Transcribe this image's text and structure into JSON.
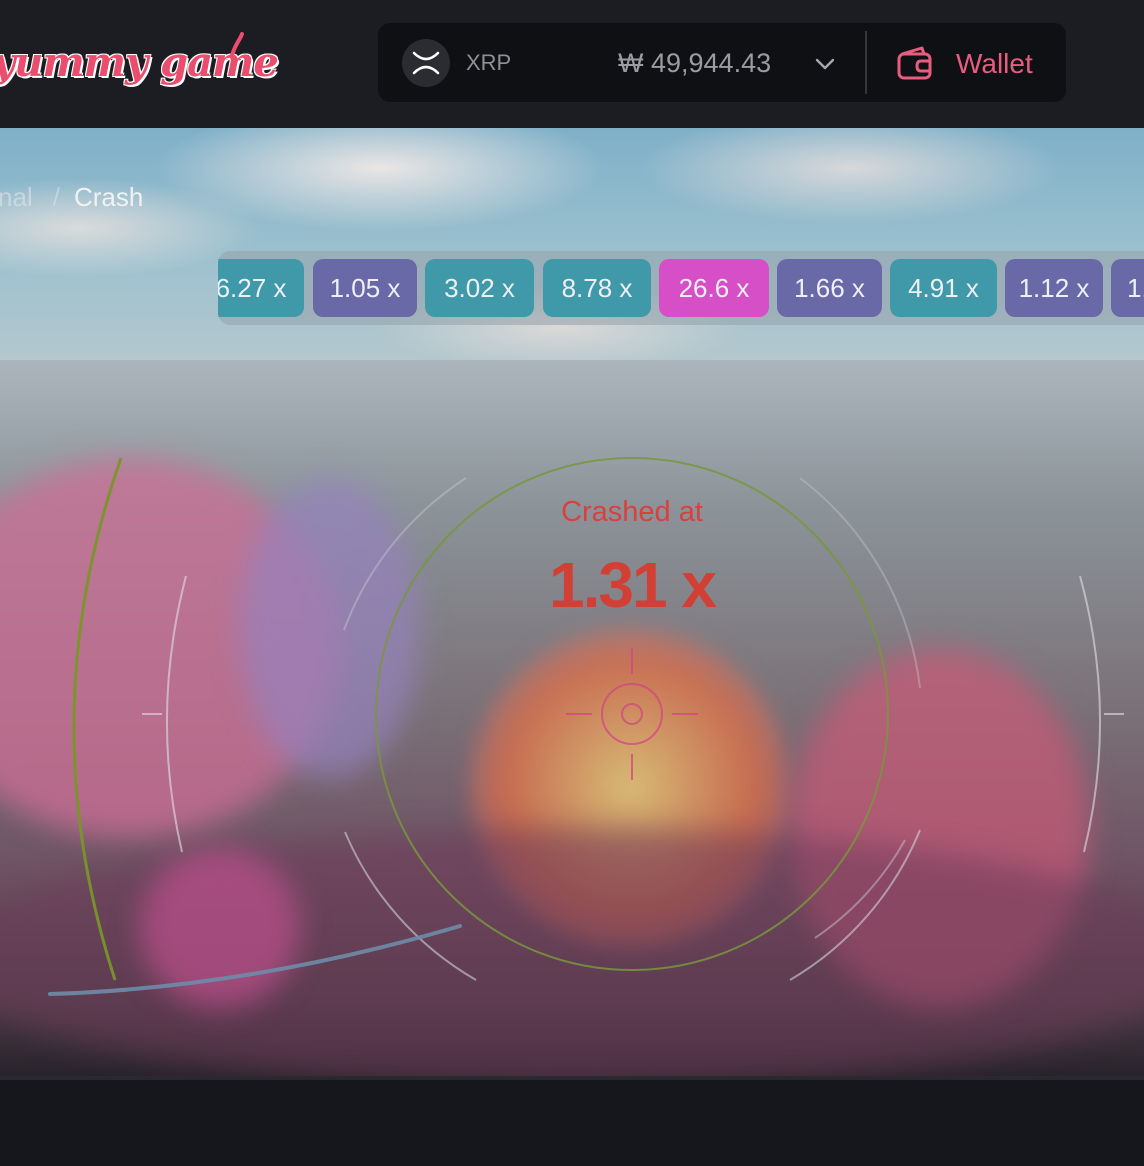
{
  "header": {
    "logo_text": "yummy game",
    "currency": {
      "code": "XRP",
      "icon": "xrp-icon"
    },
    "balance": "₩ 49,944.43",
    "wallet_label": "Wallet",
    "accent_color": "#ea5b80"
  },
  "breadcrumb": {
    "previous": "nal",
    "separator": "/",
    "current": "Crash"
  },
  "history": [
    {
      "label": "6.27 x",
      "tone": "teal"
    },
    {
      "label": "1.05 x",
      "tone": "purple"
    },
    {
      "label": "3.02 x",
      "tone": "teal"
    },
    {
      "label": "8.78 x",
      "tone": "teal"
    },
    {
      "label": "26.6 x",
      "tone": "pink"
    },
    {
      "label": "1.66 x",
      "tone": "purple"
    },
    {
      "label": "4.91 x",
      "tone": "teal"
    },
    {
      "label": "1.12 x",
      "tone": "purple"
    },
    {
      "label": "1.",
      "tone": "purple"
    }
  ],
  "game": {
    "status_label": "Crashed at",
    "crash_value": "1.31 x",
    "status_color": "#d9403e"
  }
}
